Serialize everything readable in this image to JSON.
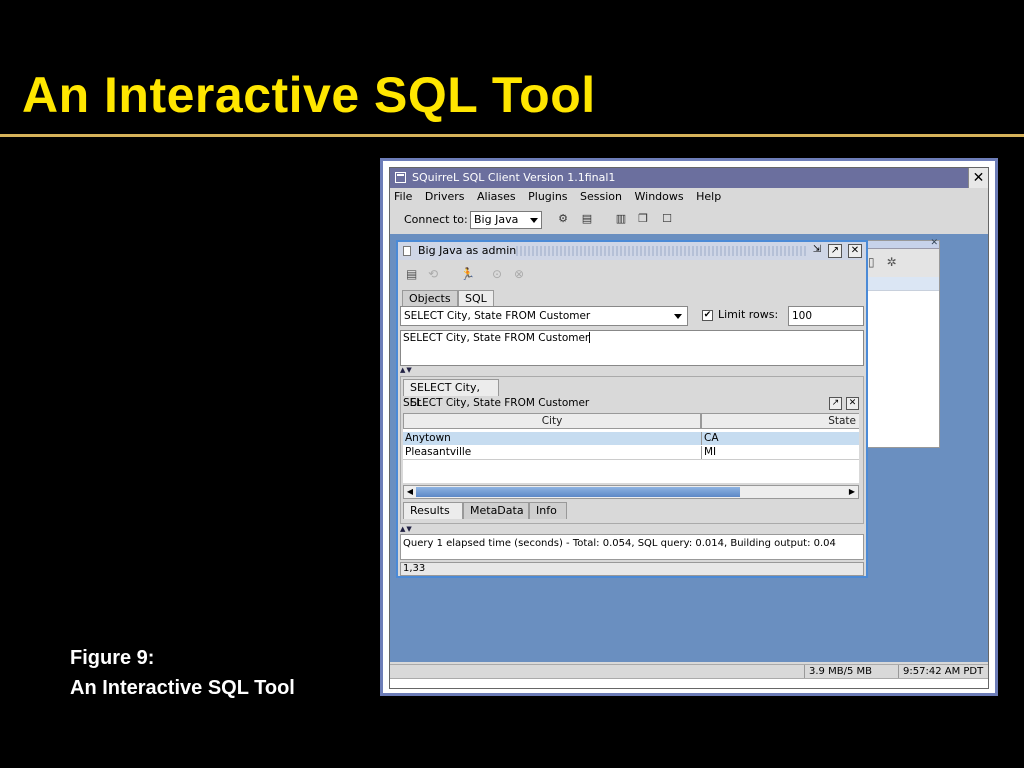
{
  "slide": {
    "title": "An Interactive SQL Tool",
    "caption_line1": "Figure 9:",
    "caption_line2": "An Interactive SQL Tool"
  },
  "window": {
    "title": "SQuirreL SQL Client Version 1.1final1",
    "close_glyph": "✕"
  },
  "menu": [
    "File",
    "Drivers",
    "Aliases",
    "Plugins",
    "Session",
    "Windows",
    "Help"
  ],
  "toolbar": {
    "connect_label": "Connect to:",
    "connect_value": "Big Java"
  },
  "session": {
    "title": "Big Java as admin",
    "tabs": [
      "Objects",
      "SQL"
    ],
    "sql_combo_value": "SELECT City, State FROM Customer",
    "limit_checked_glyph": "✔",
    "limit_label": "Limit rows:",
    "limit_value": "100",
    "editor_text": "SELECT City, State FROM Customer",
    "splitter_glyph": "▲▼"
  },
  "results": {
    "tab_label": "SELECT City, St",
    "query_text": "SELECT City, State FROM Customer",
    "columns": [
      "City",
      "State"
    ],
    "rows": [
      [
        "Anytown",
        "CA"
      ],
      [
        "Pleasantville",
        "MI"
      ]
    ],
    "bottom_tabs": [
      "Results",
      "MetaData",
      "Info"
    ]
  },
  "status": {
    "message": "Query 1 elapsed time (seconds) - Total: 0.054, SQL query: 0.014, Building output: 0.04",
    "position": "1,33",
    "memory": "3.9 MB/5 MB",
    "clock": "9:57:42 AM PDT"
  },
  "colors": {
    "title_yellow": "#ffe600",
    "desktop_blue": "#6a8fc0",
    "frame_blue": "#4b8ad6"
  }
}
